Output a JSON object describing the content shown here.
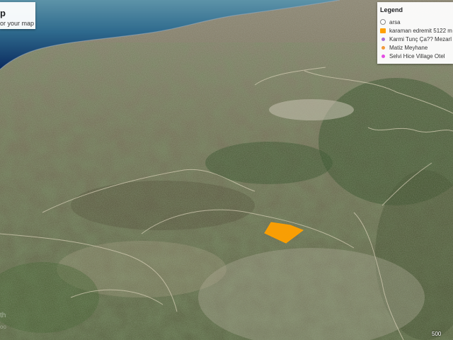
{
  "map": {
    "title": "p",
    "subtitle": "or your map",
    "scale_label": "500",
    "watermark": "th",
    "watermark_sub": "oo",
    "colors": {
      "sea_deep": "#0a2a5e",
      "sea_shallow": "#3f7c9a",
      "land": "#7a7158",
      "forest": "#2f4a22",
      "parcel": "#ffa000"
    }
  },
  "legend": {
    "title": "Legend",
    "items": [
      {
        "label": "arsa",
        "icon": "outline-polygon-icon",
        "color": "#ffffff"
      },
      {
        "label": "karaman edremit 5122 m",
        "icon": "orange-polygon-icon",
        "color": "#ffa000"
      },
      {
        "label": "Karmi Tunç Ça?? Mezarl",
        "icon": "purple-pin-icon",
        "color": "#a56ed6"
      },
      {
        "label": "Matiz Meyhane",
        "icon": "orange-pin-icon",
        "color": "#f29a3a"
      },
      {
        "label": "Selvi Hice Village Otel",
        "icon": "pink-pin-icon",
        "color": "#e44ee4"
      }
    ]
  }
}
